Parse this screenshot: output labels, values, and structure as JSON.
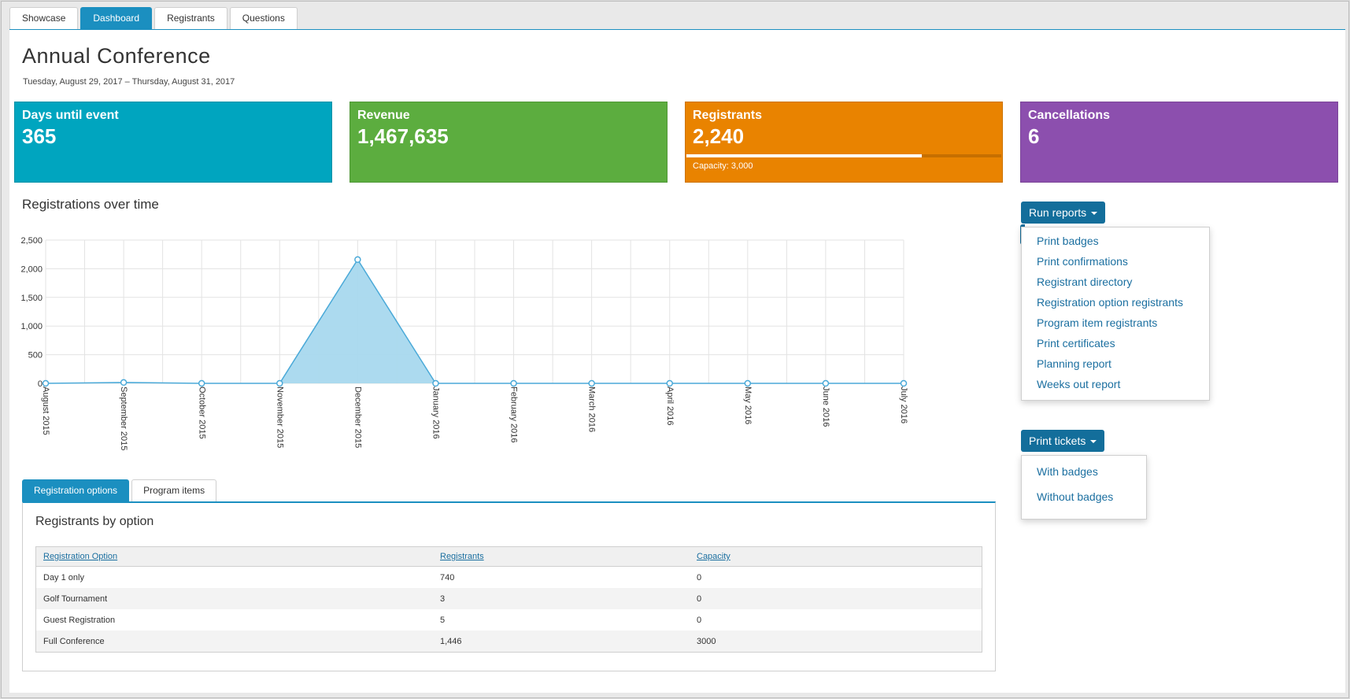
{
  "tabs": [
    "Showcase",
    "Dashboard",
    "Registrants",
    "Questions"
  ],
  "active_tab": "Dashboard",
  "event": {
    "title": "Annual Conference",
    "dates": "Tuesday, August 29, 2017 – Thursday, August 31, 2017"
  },
  "cards": {
    "days": {
      "label": "Days until event",
      "value": "365",
      "color": "#00a5bf"
    },
    "revenue": {
      "label": "Revenue",
      "value": "1,467,635",
      "color": "#5cad3f"
    },
    "registrants": {
      "label": "Registrants",
      "value": "2,240",
      "capacity": "Capacity: 3,000",
      "fill_fraction": 0.747,
      "color": "#e98300"
    },
    "cancellations": {
      "label": "Cancellations",
      "value": "6",
      "color": "#8c4fae"
    }
  },
  "chart_title": "Registrations over time",
  "chart_data": {
    "type": "area",
    "categories": [
      "August 2015",
      "September 2015",
      "October 2015",
      "November 2015",
      "December 2015",
      "January 2016",
      "February 2016",
      "March 2016",
      "April 2016",
      "May 2016",
      "June 2016",
      "July 2016"
    ],
    "values": [
      0,
      15,
      0,
      0,
      2160,
      0,
      0,
      0,
      0,
      0,
      0,
      0
    ],
    "yticks": [
      "0",
      "500",
      "1,000",
      "1,500",
      "2,000",
      "2,500"
    ],
    "ylim": [
      0,
      2500
    ],
    "grid": true,
    "fill_color": "#a8d8ee",
    "line_color": "#4aa9d8"
  },
  "bottom_tabs": [
    "Registration options",
    "Program items"
  ],
  "bottom_active": "Registration options",
  "table": {
    "title": "Registrants by option",
    "headers": [
      "Registration Option",
      "Registrants",
      "Capacity"
    ],
    "rows": [
      [
        "Day 1 only",
        "740",
        "0"
      ],
      [
        "Golf Tournament",
        "3",
        "0"
      ],
      [
        "Guest Registration",
        "5",
        "0"
      ],
      [
        "Full Conference",
        "1,446",
        "3000"
      ]
    ]
  },
  "run_reports": {
    "label": "Run reports",
    "items": [
      "Print badges",
      "Print confirmations",
      "Registrant directory",
      "Registration option registrants",
      "Program item registrants",
      "Print certificates",
      "Planning report",
      "Weeks out report"
    ]
  },
  "print_tickets": {
    "label": "Print tickets",
    "items": [
      "With badges",
      "Without badges"
    ]
  }
}
